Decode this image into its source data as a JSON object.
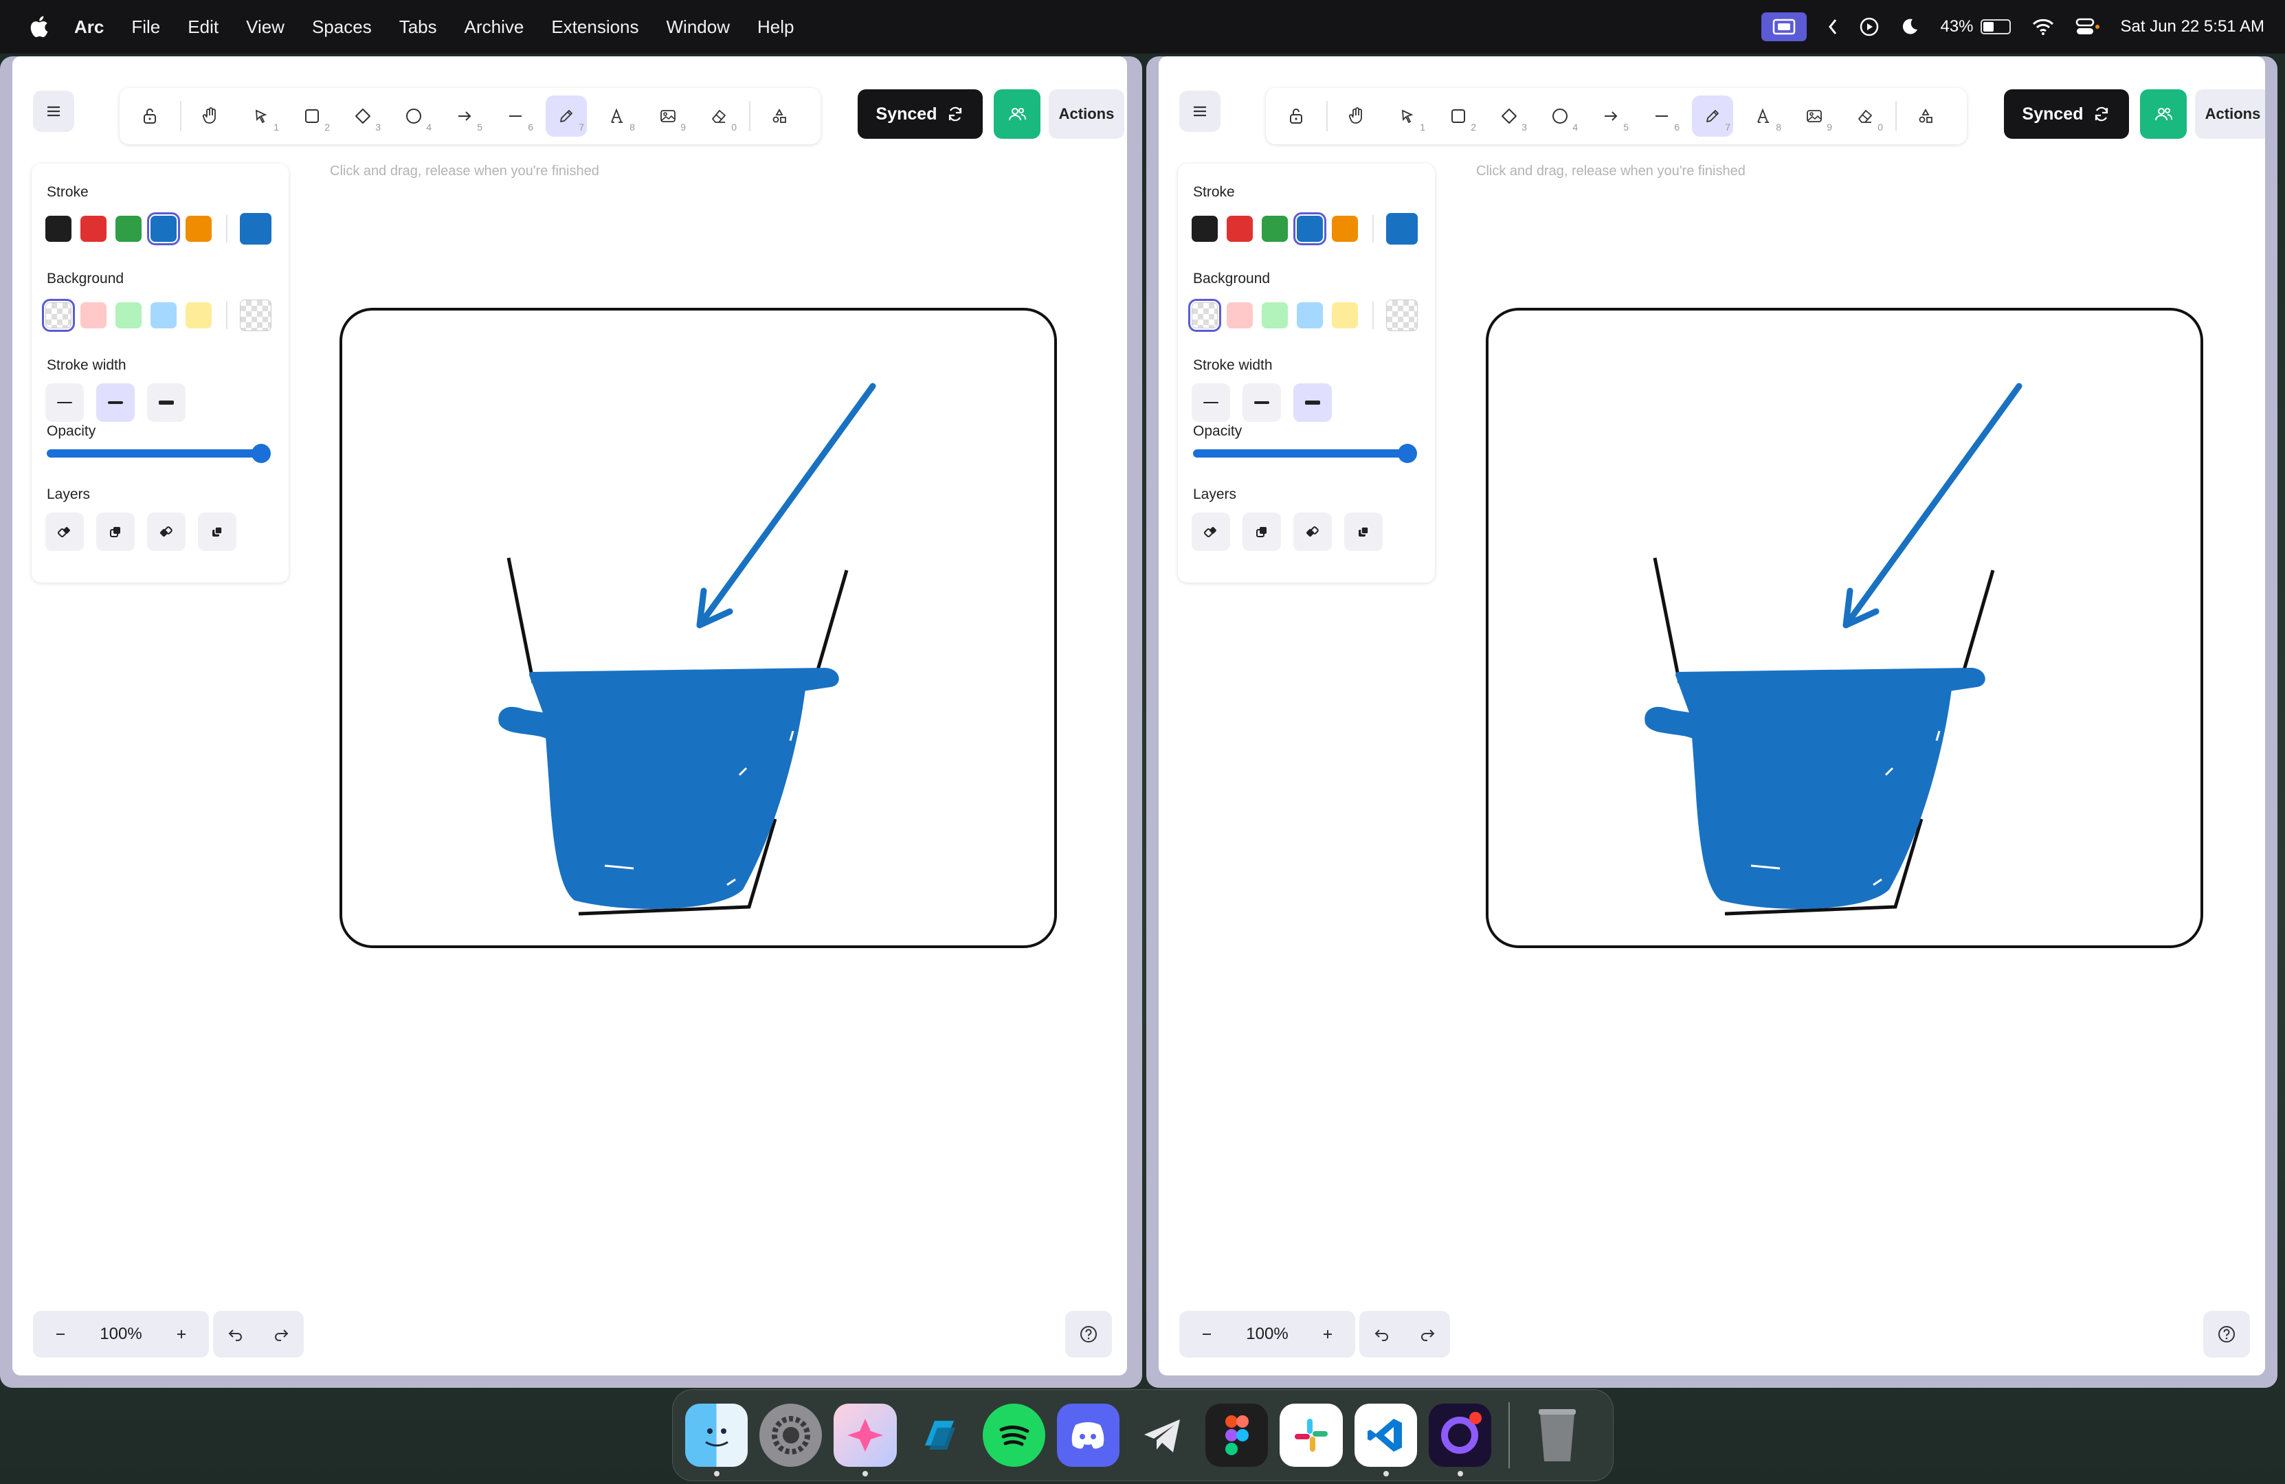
{
  "menubar": {
    "app": "Arc",
    "items": [
      "File",
      "Edit",
      "View",
      "Spaces",
      "Tabs",
      "Archive",
      "Extensions",
      "Window",
      "Help"
    ],
    "battery": "43%",
    "datetime": "Sat Jun 22  5:51 AM"
  },
  "editor": {
    "synced_label": "Synced",
    "actions_label": "Actions",
    "hint": "Click and drag, release when you're finished",
    "tool_numbers": [
      "1",
      "2",
      "3",
      "4",
      "5",
      "6",
      "7",
      "8",
      "9",
      "0"
    ],
    "panel": {
      "stroke_label": "Stroke",
      "background_label": "Background",
      "stroke_width_label": "Stroke width",
      "opacity_label": "Opacity",
      "layers_label": "Layers",
      "opacity": 1.0
    },
    "zoom": "100%"
  },
  "colors": {
    "stroke_swatches": [
      "#1e1e1e",
      "#e03131",
      "#2f9e44",
      "#1971c2",
      "#f08c00"
    ],
    "background_swatches": [
      "transparent",
      "#ffc9c9",
      "#b2f2bb",
      "#a5d8ff",
      "#ffec99"
    ],
    "current_stroke": "#1971c2",
    "accent": "#5b5bd6",
    "collab": "#19b97f"
  },
  "windows": [
    {
      "selected_stroke_width": 1
    },
    {
      "selected_stroke_width": 2
    }
  ],
  "dock": {
    "apps": [
      "finder-icon",
      "system-settings-icon",
      "pixelmator-icon",
      "files-icon",
      "spotify-icon",
      "discord-icon",
      "telegram-icon",
      "figma-icon",
      "slack-icon",
      "vscode-icon",
      "arc-icon",
      "trash-icon"
    ]
  }
}
